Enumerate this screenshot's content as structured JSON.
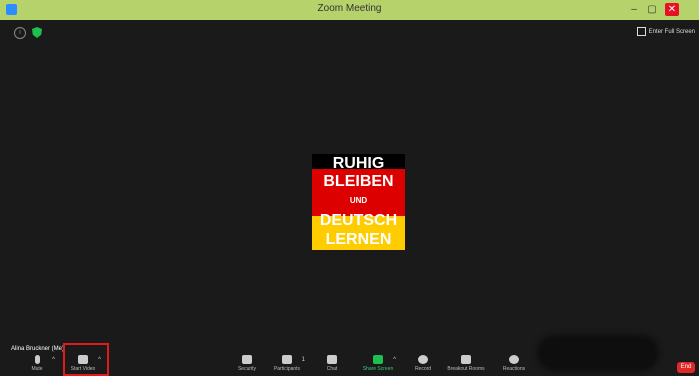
{
  "window": {
    "title": "Zoom Meeting",
    "minimize": "–",
    "maximize": "▢",
    "close": "✕"
  },
  "top_left_icons": [
    {
      "name": "info-icon"
    },
    {
      "name": "shield-icon",
      "color": "#1fbf4f"
    }
  ],
  "full_screen_label": "Enter Full Screen",
  "shared_content": {
    "line1": "RUHIG",
    "line2": "BLEIBEN",
    "line3": "UND",
    "line4": "DEUTSCH",
    "line5": "LERNEN",
    "colors": {
      "black": "#000000",
      "red": "#dd0000",
      "gold": "#ffcc00"
    }
  },
  "participant_name": "Alina Bruckner (Me)",
  "toolbar": {
    "mute": "Mute",
    "start_video": "Start Video",
    "security": "Security",
    "participants": "Participants",
    "participant_count": "1",
    "chat": "Chat",
    "share_screen": "Share Screen",
    "record": "Record",
    "breakout_rooms": "Breakout Rooms",
    "reactions": "Reactions",
    "end": "End"
  },
  "accent_colors": {
    "titlebar": "#b5d36a",
    "share": "#1fbf4f",
    "end": "#e02828",
    "highlight": "#e01b1b"
  }
}
